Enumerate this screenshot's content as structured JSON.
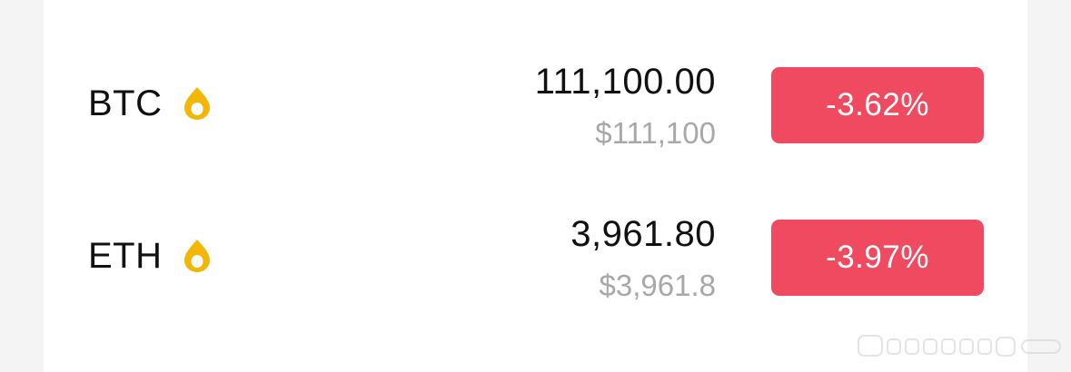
{
  "markets": [
    {
      "symbol": "BTC",
      "icon": "flame-icon",
      "price": "111,100.00",
      "usd_value": "$111,100",
      "change": "-3.62%"
    },
    {
      "symbol": "ETH",
      "icon": "flame-icon",
      "price": "3,961.80",
      "usd_value": "$3,961.8",
      "change": "-3.97%"
    }
  ],
  "colors": {
    "negative": "#f04a60",
    "icon": "#f2b705",
    "muted_text": "#a8a8a8"
  }
}
